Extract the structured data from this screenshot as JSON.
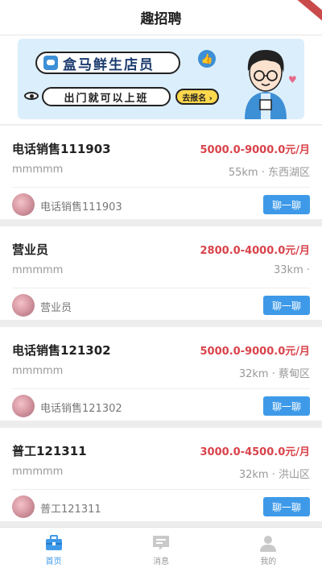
{
  "header": {
    "title": "趣招聘"
  },
  "banner": {
    "headline": "盒马鲜生店员",
    "subline": "出门就可以上班",
    "cta": "去报名 ›"
  },
  "jobs": [
    {
      "title": "电话销售111903",
      "salary": "5000.0-9000.0元/月",
      "company": "mmmmm",
      "location": "55km · 东西湖区",
      "contact": "电话销售111903",
      "chat_label": "聊一聊"
    },
    {
      "title": "营业员",
      "salary": "2800.0-4000.0元/月",
      "company": "mmmmm",
      "location": "33km ·",
      "contact": "营业员",
      "chat_label": "聊一聊"
    },
    {
      "title": "电话销售121302",
      "salary": "5000.0-9000.0元/月",
      "company": "mmmmm",
      "location": "32km · 蔡甸区",
      "contact": "电话销售121302",
      "chat_label": "聊一聊"
    },
    {
      "title": "普工121311",
      "salary": "3000.0-4500.0元/月",
      "company": "mmmmm",
      "location": "32km · 洪山区",
      "contact": "普工121311",
      "chat_label": "聊一聊"
    }
  ],
  "tabs": [
    {
      "label": "首页",
      "icon": "briefcase-icon",
      "active": true
    },
    {
      "label": "消息",
      "icon": "message-icon",
      "active": false
    },
    {
      "label": "我的",
      "icon": "user-icon",
      "active": false
    }
  ],
  "colors": {
    "accent": "#3e9ae8",
    "salary": "#d9434b"
  }
}
